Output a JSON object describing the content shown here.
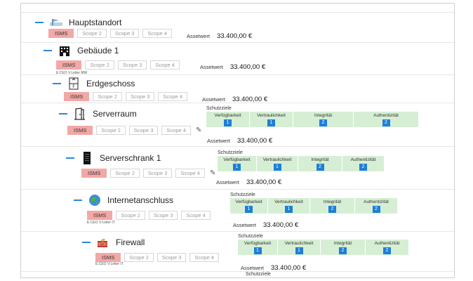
{
  "scope_labels": {
    "isms": "ISMS",
    "scope2": "Scope 2",
    "scope3": "Scope 3",
    "scope4": "Scope 4"
  },
  "asset_label": "Assetwert",
  "schutzziele_label": "Schutzziele",
  "schutzziel_headers": [
    "Verfügbarkeit",
    "Vertraulichkeit",
    "Integrität",
    "Authentizität"
  ],
  "colors": {
    "isms_chip": "#f2a8a6",
    "tree_dash": "#2b86d9",
    "schutzziel_cell": "#d6efd4",
    "schutzziel_badge": "#1d7fd8"
  },
  "nodes": [
    {
      "title": "Hauptstandort",
      "icon": "location-flag-icon",
      "owner": "",
      "asset_value": "33.400,00 €",
      "editable": false,
      "schutzziele": []
    },
    {
      "title": "Gebäude 1",
      "icon": "building-icon",
      "owner": "E:CEO V:Leiter MW",
      "asset_value": "33.400,00 €",
      "editable": false,
      "schutzziele": []
    },
    {
      "title": "Erdgeschoss",
      "icon": "floor-icon",
      "owner": "",
      "asset_value": "33.400,00 €",
      "editable": false,
      "schutzziele": []
    },
    {
      "title": "Serverraum",
      "icon": "door-icon",
      "owner": "",
      "asset_value": "33.400,00 €",
      "editable": true,
      "schutzziele": [
        "1",
        "1",
        "2",
        "2"
      ]
    },
    {
      "title": "Serverschrank 1",
      "icon": "server-rack-icon",
      "owner": "",
      "asset_value": "33.400,00 €",
      "editable": true,
      "schutzziele": [
        "1",
        "1",
        "2",
        "2"
      ]
    },
    {
      "title": "Internetanschluss",
      "icon": "globe-icon",
      "owner": "E:CEO V:Leiter IT",
      "asset_value": "33.400,00 €",
      "editable": false,
      "schutzziele": [
        "1",
        "1",
        "2",
        "2"
      ]
    },
    {
      "title": "Firewall",
      "icon": "firewall-icon",
      "owner": "E:CEO V:Leiter IT",
      "asset_value": "33.400,00 €",
      "editable": false,
      "schutzziele": [
        "1",
        "1",
        "2",
        "2"
      ]
    }
  ]
}
